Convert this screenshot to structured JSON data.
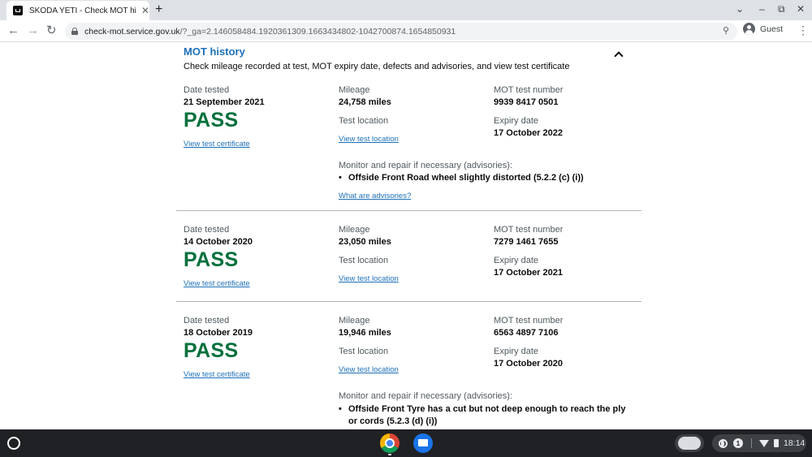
{
  "browser": {
    "tab_title": "SKODA YETI - Check MOT history",
    "tab_close": "✕",
    "new_tab": "+",
    "url_domain": "check-mot.service.gov.uk",
    "url_path": "/?_ga=2.146058484.1920361309.1663434802-1042700874.1654850931",
    "profile_label": "Guest",
    "window_controls": [
      "⌄",
      "–",
      "⧉",
      "✕"
    ]
  },
  "page": {
    "section_title": "MOT history",
    "section_description": "Check mileage recorded at test, MOT expiry date, defects and advisories, and view test certificate",
    "labels": {
      "date_tested": "Date tested",
      "mileage": "Mileage",
      "mot_test_number": "MOT test number",
      "test_location": "Test location",
      "expiry_date": "Expiry date",
      "advisories_heading": "Monitor and repair if necessary (advisories):"
    },
    "links": {
      "view_certificate": "View test certificate",
      "view_location": "View test location",
      "what_are_advisories": "What are advisories?"
    },
    "tests": [
      {
        "date": "21 September 2021",
        "result": "PASS",
        "mileage": "24,758 miles",
        "test_number": "9939 8417 0501",
        "expiry": "17 October 2022",
        "advisories": [
          "Offside Front Road wheel slightly distorted (5.2.2 (c) (i))"
        ]
      },
      {
        "date": "14 October 2020",
        "result": "PASS",
        "mileage": "23,050 miles",
        "test_number": "7279 1461 7655",
        "expiry": "17 October 2021",
        "advisories": []
      },
      {
        "date": "18 October 2019",
        "result": "PASS",
        "mileage": "19,946 miles",
        "test_number": "6563 4897 7106",
        "expiry": "17 October 2020",
        "advisories": [
          "Offside Front Tyre has a cut but not deep enough to reach the ply or cords (5.2.3 (d) (i))"
        ]
      }
    ]
  },
  "shelf": {
    "notification_count": "1",
    "time": "18:14"
  },
  "colors": {
    "link": "#1d70b8",
    "pass": "#00703c",
    "text": "#0b0c0c",
    "secondary_text": "#505a5f"
  }
}
